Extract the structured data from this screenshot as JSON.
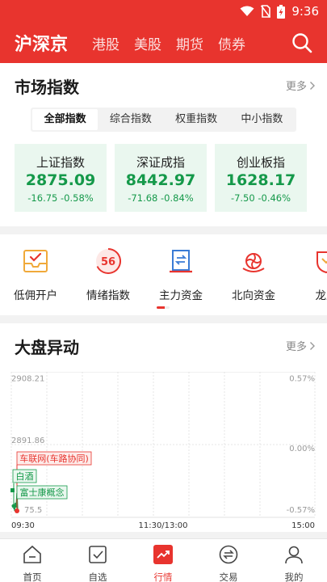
{
  "status_bar": {
    "time": "9:36"
  },
  "header": {
    "active_tab": "沪深京",
    "tabs": [
      "港股",
      "美股",
      "期货",
      "债券"
    ],
    "search_icon": "search-icon"
  },
  "market_index": {
    "title": "市场指数",
    "more": "更多",
    "segments": [
      "全部指数",
      "综合指数",
      "权重指数",
      "中小指数"
    ],
    "active_segment": 0,
    "indices": [
      {
        "name": "上证指数",
        "value": "2875.09",
        "change": "-16.75",
        "pct": "-0.58%"
      },
      {
        "name": "深证成指",
        "value": "8442.97",
        "change": "-71.68",
        "pct": "-0.84%"
      },
      {
        "name": "创业板指",
        "value": "1628.17",
        "change": "-7.50",
        "pct": "-0.46%"
      }
    ],
    "colors": {
      "down": "#15994a",
      "down_bg": "#eaf7ef"
    }
  },
  "entries": [
    {
      "label": "低佣开户",
      "icon": "account-open-icon"
    },
    {
      "label": "情绪指数",
      "icon": "sentiment-gauge-icon",
      "badge": "56"
    },
    {
      "label": "主力资金",
      "icon": "main-funds-icon"
    },
    {
      "label": "北向资金",
      "icon": "northbound-bauhinia-icon"
    },
    {
      "label": "龙虎",
      "icon": "dragon-tiger-icon"
    }
  ],
  "movers": {
    "title": "大盘异动",
    "more": "更多",
    "y_left": [
      "2908.21",
      "2891.86",
      "75.5"
    ],
    "y_right": [
      "0.57%",
      "0.00%",
      "-0.57%"
    ],
    "x_labels": [
      "09:30",
      "11:30/13:00",
      "15:00"
    ],
    "tags": [
      {
        "label": "车联网(车路协同)",
        "kind": "up"
      },
      {
        "label": "白酒",
        "kind": "down"
      },
      {
        "label": "富士康概念",
        "kind": "down"
      }
    ],
    "colors": {
      "up": "#e8342e",
      "down": "#15994a"
    }
  },
  "bottom_nav": [
    {
      "label": "首页",
      "icon": "home-icon"
    },
    {
      "label": "自选",
      "icon": "watchlist-icon"
    },
    {
      "label": "行情",
      "icon": "market-trend-icon",
      "active": true
    },
    {
      "label": "交易",
      "icon": "trade-exchange-icon"
    },
    {
      "label": "我的",
      "icon": "profile-icon"
    }
  ],
  "brand_color": "#e8342e"
}
